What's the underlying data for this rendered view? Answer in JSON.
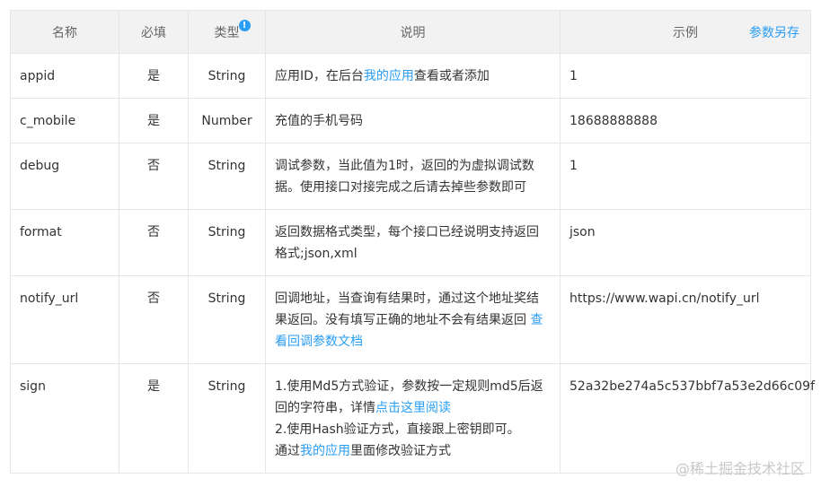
{
  "header": {
    "name": "名称",
    "required": "必填",
    "type": "类型",
    "info_icon": "!",
    "description": "说明",
    "example": "示例",
    "save_as": "参数另存"
  },
  "rows": [
    {
      "name": "appid",
      "required": "是",
      "type": "String",
      "desc_pre": "应用ID，在后台",
      "desc_link": "我的应用",
      "desc_post": "查看或者添加",
      "example": "1"
    },
    {
      "name": "c_mobile",
      "required": "是",
      "type": "Number",
      "desc": "充值的手机号码",
      "example": "18688888888"
    },
    {
      "name": "debug",
      "required": "否",
      "type": "String",
      "desc_line1": "调试参数，当此值为1时，返回的为虚拟调试数",
      "desc_line2": "据。使用接口对接完成之后请去掉些参数即可",
      "example": "1"
    },
    {
      "name": "format",
      "required": "否",
      "type": "String",
      "desc_line1": "返回数据格式类型，每个接口已经说明支持返回",
      "desc_line2": "格式;json,xml",
      "example": "json"
    },
    {
      "name": "notify_url",
      "required": "否",
      "type": "String",
      "desc_line1": "回调地址，当查询有结果时，通过这个地址奖结",
      "desc_line2_pre": "果返回。没有填写正确的地址不会有结果返回 ",
      "desc_line2_link": "查",
      "desc_line3_link": "看回调参数文档",
      "example": "https://www.wapi.cn/notify_url"
    },
    {
      "name": "sign",
      "required": "是",
      "type": "String",
      "desc_line1": "1.使用Md5方式验证，参数按一定规则md5后返",
      "desc_line2_pre": "回的字符串，详情",
      "desc_line2_link": "点击这里阅读",
      "desc_line3": "2.使用Hash验证方式，直接跟上密钥即可。",
      "desc_line4_pre": "通过",
      "desc_line4_link": "我的应用",
      "desc_line4_post": "里面修改验证方式",
      "example": "52a32be274a5c537bbf7a53e2d66c09f"
    }
  ],
  "watermark": "@稀土掘金技术社区"
}
